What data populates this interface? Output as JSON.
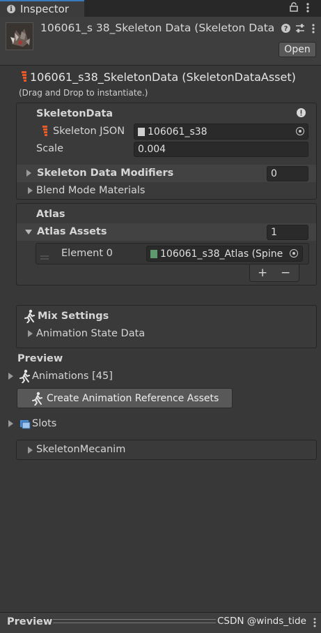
{
  "tab": {
    "title": "Inspector",
    "info_icon": "i",
    "lock_icon": "lock-icon",
    "menu_icon": "more-vertical-icon"
  },
  "header": {
    "title": "106061_s 38_Skeleton Data (Skeleton Data",
    "help_icon": "question-icon",
    "settings_icon": "sliders-icon",
    "menu_icon": "more-vertical-icon",
    "open_label": "Open"
  },
  "asset": {
    "title": "106061_s38_SkeletonData (SkeletonDataAsset)",
    "hint": "(Drag and Drop to instantiate.)"
  },
  "skeleton_data": {
    "heading": "SkeletonData",
    "json_label": "Skeleton JSON",
    "json_value": "106061_s38",
    "scale_label": "Scale",
    "scale_value": "0.004",
    "modifiers_label": "Skeleton Data Modifiers",
    "modifiers_count": "0",
    "blend_label": "Blend Mode Materials"
  },
  "atlas": {
    "heading": "Atlas",
    "assets_label": "Atlas Assets",
    "assets_count": "1",
    "element_label": "Element 0",
    "element_value": "106061_s38_Atlas (Spine",
    "add_label": "+",
    "remove_label": "−"
  },
  "mix": {
    "heading": "Mix Settings",
    "state_label": "Animation State Data"
  },
  "preview": {
    "heading": "Preview",
    "animations_label": "Animations [45]",
    "create_button": "Create Animation Reference Assets",
    "slots_label": "Slots",
    "mecanim_label": "SkeletonMecanim"
  },
  "footer": {
    "label": "Preview",
    "watermark": "CSDN @winds_tide"
  },
  "colors": {
    "background": "#383838",
    "accent_tab": "#3a79bb",
    "field": "#2a2a2a",
    "button": "#585858"
  }
}
